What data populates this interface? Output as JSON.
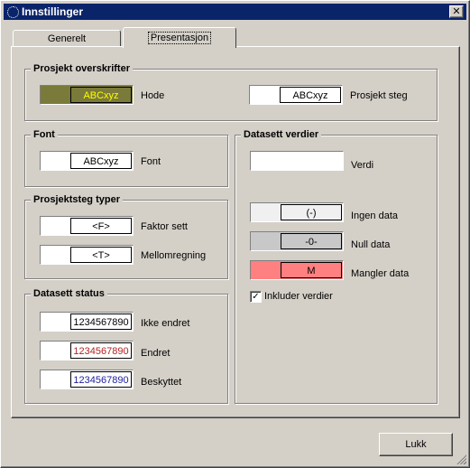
{
  "window": {
    "title": "Innstillinger",
    "close_label": "✕"
  },
  "tabs": [
    {
      "label": "Generelt",
      "active": false
    },
    {
      "label": "Presentasjon",
      "active": true
    }
  ],
  "groups": {
    "prosjekt_overskrifter": {
      "title": "Prosjekt overskrifter",
      "hode": {
        "sample": "ABCxyz",
        "label": "Hode",
        "bg": "#7a7a3a",
        "fg": "#ffff00"
      },
      "prosjekt_steg": {
        "sample": "ABCxyz",
        "label": "Prosjekt steg",
        "bg": "#ffffff",
        "fg": "#000000"
      }
    },
    "font": {
      "title": "Font",
      "font": {
        "sample": "ABCxyz",
        "label": "Font"
      }
    },
    "prosjektsteg_typer": {
      "title": "Prosjektsteg typer",
      "faktor_sett": {
        "sample": "<F>",
        "label": "Faktor sett"
      },
      "mellomregning": {
        "sample": "<T>",
        "label": "Mellomregning"
      }
    },
    "datasett_status": {
      "title": "Datasett status",
      "ikke_endret": {
        "sample": "1234567890",
        "label": "Ikke endret",
        "fg": "#000000"
      },
      "endret": {
        "sample": "1234567890",
        "label": "Endret",
        "fg": "#b22222"
      },
      "beskyttet": {
        "sample": "1234567890",
        "label": "Beskyttet",
        "fg": "#1c1ca0"
      }
    },
    "datasett_verdier": {
      "title": "Datasett verdier",
      "verdi": {
        "sample": "",
        "label": "Verdi"
      },
      "ingen_data": {
        "sample": "(-)",
        "label": "Ingen data",
        "bg": "#f0f0f0"
      },
      "null_data": {
        "sample": "-0-",
        "label": "Null data",
        "bg": "#c8c8c8"
      },
      "mangler_data": {
        "sample": "M",
        "label": "Mangler data",
        "bg": "#ff8080"
      },
      "inkluder": {
        "label": "Inkluder verdier",
        "checked": true,
        "mark": "✓"
      }
    }
  },
  "footer": {
    "close_button": "Lukk"
  }
}
